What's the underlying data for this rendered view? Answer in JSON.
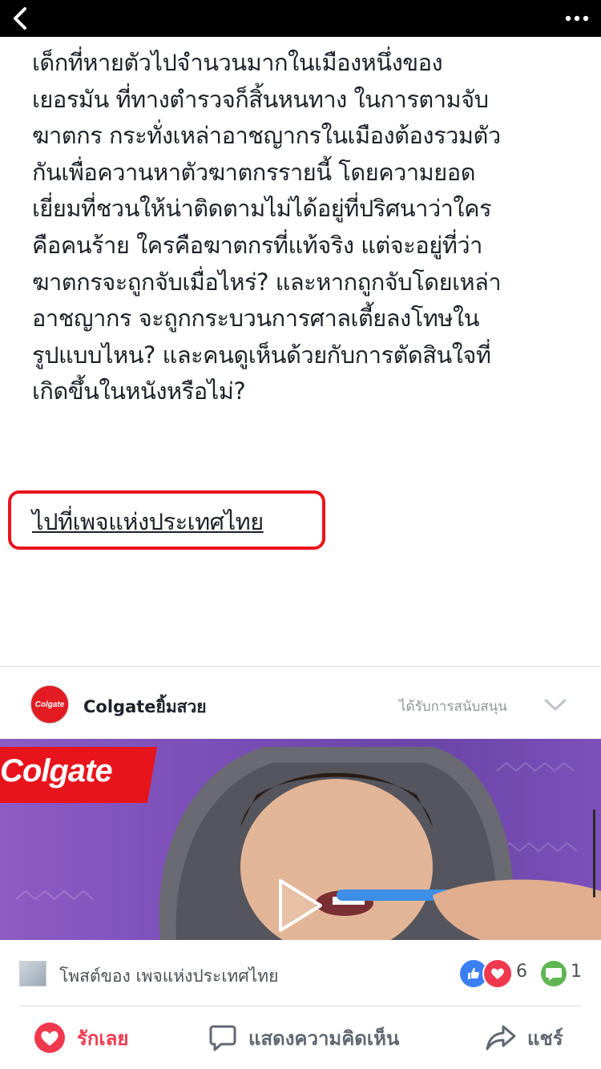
{
  "article": {
    "text": "เด็กที่หายตัวไปจำนวนมากในเมืองหนึ่งของ\nเยอรมัน ที่ทางตำรวจก็สิ้นหนทาง ในการตามจับ\nฆาตกร กระทั่งเหล่าอาชญากรในเมืองต้องรวมตัว\nกันเพื่อควานหาตัวฆาตกรรายนี้ โดยความยอด\nเยี่ยมที่ชวนให้น่าติดตามไม่ได้อยู่ที่ปริศนาว่าใคร\nคือคนร้าย ใครคือฆาตกรที่แท้จริง แต่จะอยู่ที่ว่า\nฆาตกรจะถูกจับเมื่อไหร่? และหากถูกจับโดยเหล่า\nอาชญากร จะถูกกระบวนการศาลเตี้ยลงโทษใน\nรูปแบบไหน? และคนดูเห็นด้วยกับการตัดสินใจที่\nเกิดขึ้นในหนังหรือไม่?",
    "page_link": "ไปที่เพจแห่งประเทศไทย"
  },
  "ad": {
    "advertiser": "Colgateยิ้มสวย",
    "avatar_text": "Colgate",
    "sponsored": "ได้รับการสนับสนุน",
    "brand": "Colgate"
  },
  "post": {
    "by": "โพสต์ของ เพจแห่งประเทศไทย",
    "reaction_count": "6",
    "comment_count": "1"
  },
  "actions": {
    "like": "รักเลย",
    "comment": "แสดงความคิดเห็น",
    "share": "แชร์"
  },
  "colors": {
    "love": "#f0384f",
    "like": "#3b7ff5",
    "highlight": "#e8151c",
    "brand": "#e8141c"
  },
  "icons": [
    "back-icon",
    "more-icon",
    "chevron-down-icon",
    "play-icon",
    "like-icon",
    "love-icon",
    "comment-icon",
    "share-icon",
    "heart-icon"
  ]
}
